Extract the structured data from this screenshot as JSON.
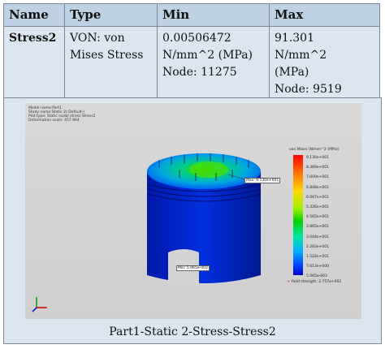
{
  "table": {
    "headers": [
      "Name",
      "Type",
      "Min",
      "Max"
    ],
    "row": {
      "name": "Stress2",
      "type_lines": [
        "VON: von",
        "Mises Stress"
      ],
      "min_lines": [
        "0.00506472",
        "N/mm^2 (MPa)",
        "Node: 11275"
      ],
      "max_lines": [
        "91.301",
        "N/mm^2",
        "(MPa)",
        "Node: 9519"
      ]
    }
  },
  "model_info": [
    "Model name:Part1",
    "Study name:Static 2(-Default-)",
    "Plot type: Static nodal stress Stress2",
    "Deformation scale: 457.964"
  ],
  "legend": {
    "title": "von Mises (N/mm^2 (MPa))",
    "ticks": [
      "9.130e+001",
      "8.369e+001",
      "7.609e+001",
      "6.848e+001",
      "6.087e+001",
      "5.326e+001",
      "4.565e+001",
      "3.805e+001",
      "3.044e+001",
      "2.283e+001",
      "1.522e+001",
      "7.613e+000",
      "5.065e-003"
    ],
    "yield": "Yield strength: 2.757e+002",
    "colors": [
      "#ff0000",
      "#ff7a00",
      "#ffd800",
      "#9af000",
      "#00d000",
      "#00e8a0",
      "#00b0ff",
      "#0040ff",
      "#0000c8"
    ]
  },
  "annotations": {
    "max": "Max: 9.130e+001",
    "min": "Min: 5.065e-003"
  },
  "caption": "Part1-Static 2-Stress-Stress2"
}
